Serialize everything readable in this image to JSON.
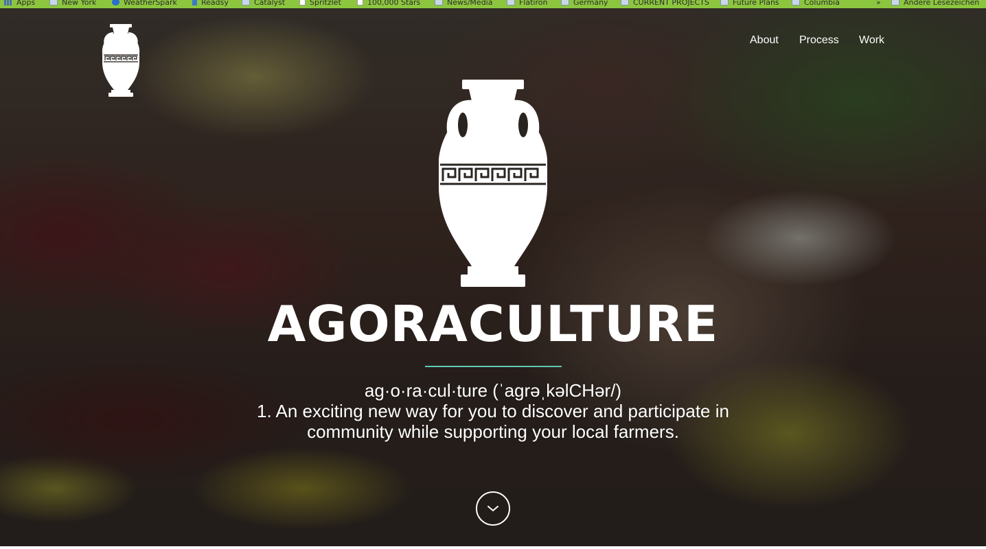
{
  "bookmarks": [
    {
      "label": "Apps",
      "icon": "apps-grid-icon"
    },
    {
      "label": "New York",
      "icon": "folder-icon"
    },
    {
      "label": "WeatherSpark",
      "icon": "weatherspark-icon"
    },
    {
      "label": "Readsy",
      "icon": "readsy-icon"
    },
    {
      "label": "Catalyst",
      "icon": "folder-icon"
    },
    {
      "label": "Spritzlet",
      "icon": "page-icon"
    },
    {
      "label": "100,000 Stars",
      "icon": "page-icon"
    },
    {
      "label": "News/Media",
      "icon": "folder-icon"
    },
    {
      "label": "Flatiron",
      "icon": "folder-icon"
    },
    {
      "label": "Germany",
      "icon": "folder-icon"
    },
    {
      "label": "CURRENT PROJECTS",
      "icon": "folder-icon"
    },
    {
      "label": "Future Plans",
      "icon": "folder-icon"
    },
    {
      "label": "Columbia",
      "icon": "folder-icon"
    }
  ],
  "bookmarks_more": "»",
  "other_bookmarks": "Andere Lesezeichen",
  "nav": {
    "items": [
      {
        "label": "About"
      },
      {
        "label": "Process"
      },
      {
        "label": "Work"
      }
    ]
  },
  "hero": {
    "title": "AGORACULTURE",
    "pronunciation": "ag·o·ra·cul·ture (ˈagrəˌkəlCHər/)",
    "definition": "1. An exciting new way for you to discover and participate in community while supporting your local farmers.",
    "accent_color": "#5fc9b3",
    "scroll_icon": "chevron-down-icon"
  },
  "colors": {
    "bookmark_bar": "#8cc63f",
    "text": "#ffffff"
  }
}
